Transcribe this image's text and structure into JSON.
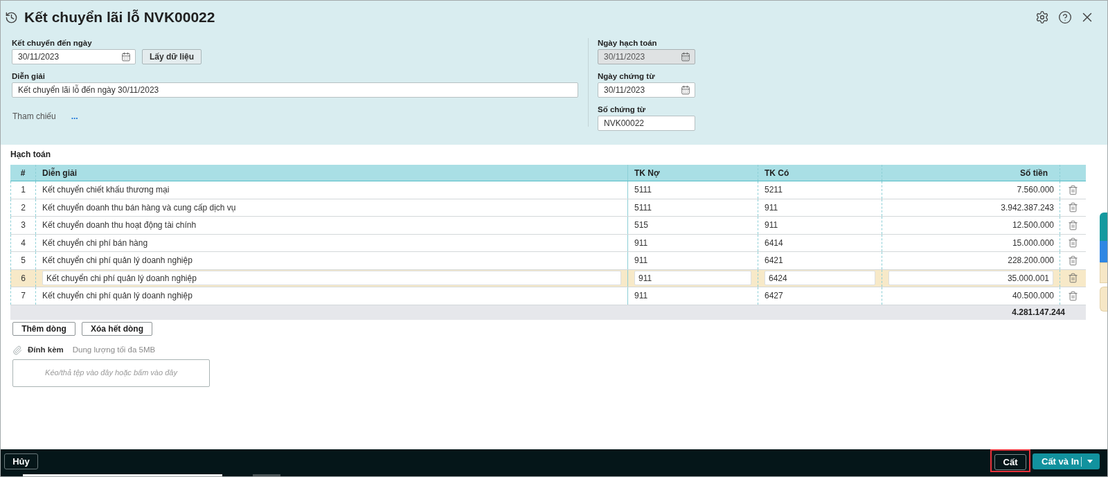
{
  "window": {
    "title": "Kết chuyển lãi lỗ NVK00022"
  },
  "form_left": {
    "transfer_date": {
      "label": "Kết chuyển đến ngày",
      "value": "30/11/2023",
      "kind": "date"
    },
    "fetch_button": "Lấy dữ liệu",
    "description": {
      "label": "Diễn giải",
      "value": "Kết chuyển lãi lỗ đến ngày 30/11/2023",
      "kind": "text"
    },
    "reference": {
      "label": "Tham chiếu",
      "link": "..."
    }
  },
  "form_right": [
    {
      "label": "Ngày hạch toán",
      "value": "30/11/2023",
      "kind": "date",
      "disabled": true
    },
    {
      "label": "Ngày chứng từ",
      "value": "30/11/2023",
      "kind": "date",
      "disabled": false
    },
    {
      "label": "Số chứng từ",
      "value": "NVK00022",
      "kind": "text",
      "disabled": false
    }
  ],
  "entries": {
    "title": "Hạch toán",
    "columns": [
      "#",
      "Diễn giải",
      "TK Nợ",
      "TK Có",
      "Số tiền"
    ],
    "rows": [
      {
        "index": "1",
        "description": "Kết chuyển chiết khấu thương mại",
        "debit": "5111",
        "credit": "5211",
        "amount": "7.560.000",
        "selected": false
      },
      {
        "index": "2",
        "description": "Kết chuyển doanh thu bán hàng và cung cấp dịch vụ",
        "debit": "5111",
        "credit": "911",
        "amount": "3.942.387.243",
        "selected": false
      },
      {
        "index": "3",
        "description": "Kết chuyển doanh thu hoạt động tài chính",
        "debit": "515",
        "credit": "911",
        "amount": "12.500.000",
        "selected": false
      },
      {
        "index": "4",
        "description": "Kết chuyển chi phí bán hàng",
        "debit": "911",
        "credit": "6414",
        "amount": "15.000.000",
        "selected": false
      },
      {
        "index": "5",
        "description": "Kết chuyển chi phí quản lý doanh nghiệp",
        "debit": "911",
        "credit": "6421",
        "amount": "228.200.000",
        "selected": false
      },
      {
        "index": "6",
        "description": "Kết chuyển chi phí quản lý doanh nghiệp",
        "debit": "911",
        "credit": "6424",
        "amount": "35.000.001",
        "selected": true
      },
      {
        "index": "7",
        "description": "Kết chuyển chi phí quản lý doanh nghiệp",
        "debit": "911",
        "credit": "6427",
        "amount": "40.500.000",
        "selected": false
      }
    ],
    "total": "4.281.147.244",
    "buttons": [
      "Thêm dòng",
      "Xóa hết dòng"
    ]
  },
  "attachment": {
    "label": "Đính kèm",
    "hint": "Dung lượng tối đa 5MB",
    "dropzone_text": "Kéo/thả tệp vào đây hoặc bấm vào đây"
  },
  "footer": {
    "cancel": "Hủy",
    "buttons": [
      {
        "label": "Cất",
        "kind": "outline",
        "highlighted": true
      },
      {
        "label": "Cất và In",
        "kind": "split",
        "highlighted": false
      }
    ]
  }
}
